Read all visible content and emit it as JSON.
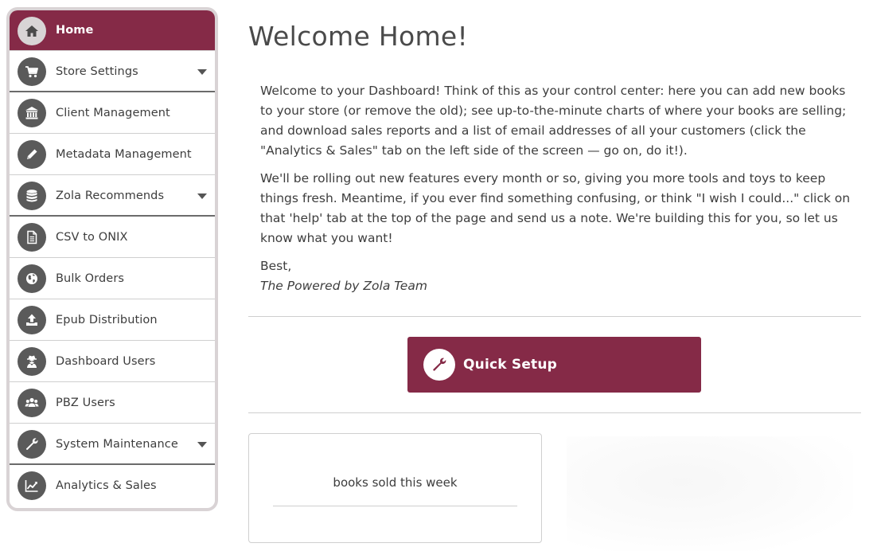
{
  "sidebar": {
    "items": [
      {
        "label": "Home",
        "icon": "home-icon"
      },
      {
        "label": "Store Settings",
        "icon": "cart-icon"
      },
      {
        "label": "Client Management",
        "icon": "bank-icon"
      },
      {
        "label": "Metadata Management",
        "icon": "pencil-icon"
      },
      {
        "label": "Zola Recommends",
        "icon": "database-icon"
      },
      {
        "label": "CSV to ONIX",
        "icon": "document-icon"
      },
      {
        "label": "Bulk Orders",
        "icon": "globe-icon"
      },
      {
        "label": "Epub Distribution",
        "icon": "upload-icon"
      },
      {
        "label": "Dashboard Users",
        "icon": "user-secret-icon"
      },
      {
        "label": "PBZ Users",
        "icon": "users-icon"
      },
      {
        "label": "System Maintenance",
        "icon": "wrench-icon"
      },
      {
        "label": "Analytics & Sales",
        "icon": "line-chart-icon"
      }
    ]
  },
  "main": {
    "title": "Welcome Home!",
    "paragraphs": [
      "Welcome to your Dashboard! Think of this as your control center: here you can add new books to your store (or remove the old); see up-to-the-minute charts of where your books are selling; and download sales reports and a list of email addresses of all your customers (click the \"Analytics & Sales\" tab on the left side of the screen — go on, do it!).",
      "We'll be rolling out new features every month or so, giving you more tools and toys to keep things fresh. Meantime, if you ever find something confusing, or think \"I wish I could...\" click on that 'help' tab at the top of the page and send us a note. We're building this for you, so let us know what you want!"
    ],
    "signoff": "Best,",
    "signature": "The Powered by Zola Team",
    "quick_setup_label": "Quick Setup",
    "card_title": "books sold this week"
  },
  "colors": {
    "accent": "#852a47",
    "icon_bg": "#5a5a5a",
    "border": "#d9d3d5"
  }
}
